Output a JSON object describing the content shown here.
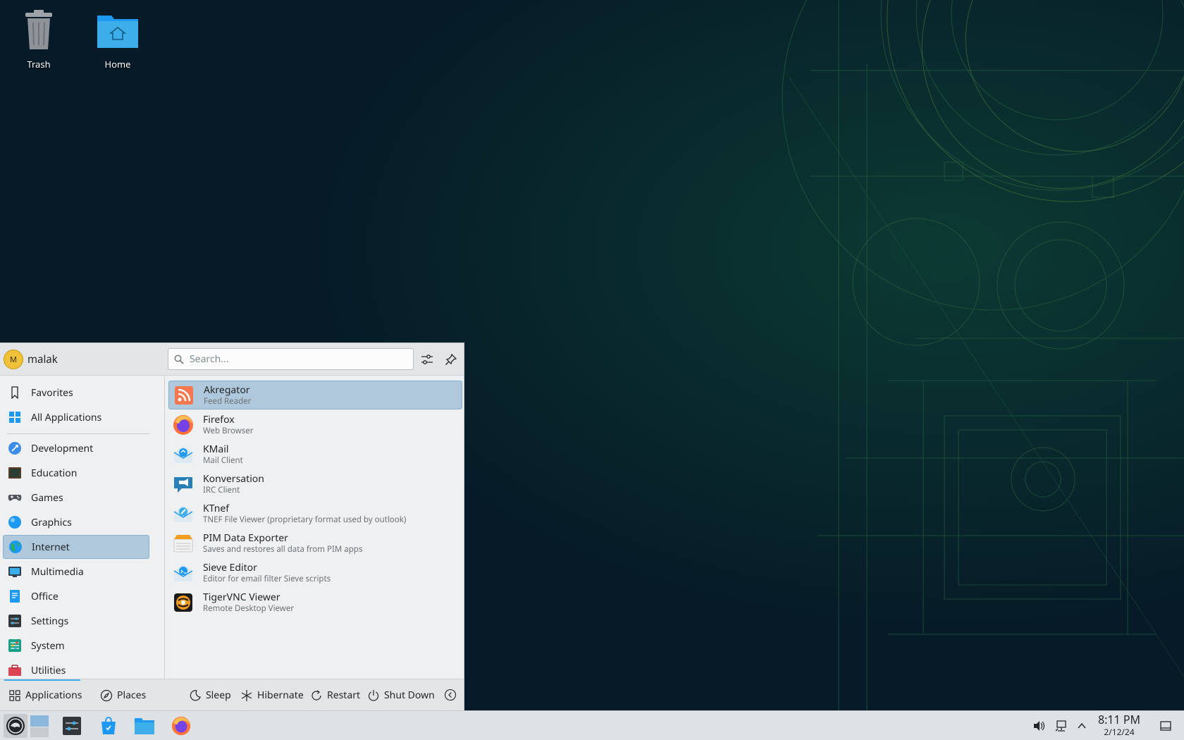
{
  "desktop": {
    "icons": [
      {
        "label": "Trash"
      },
      {
        "label": "Home"
      }
    ]
  },
  "launcher": {
    "user": {
      "initial": "M",
      "name": "malak"
    },
    "search": {
      "placeholder": "Search..."
    },
    "categories": [
      {
        "label": "Favorites",
        "icon": "bookmark-icon"
      },
      {
        "label": "All Applications",
        "icon": "grid-icon"
      },
      {
        "label": "Development",
        "icon": "development-icon"
      },
      {
        "label": "Education",
        "icon": "education-icon"
      },
      {
        "label": "Games",
        "icon": "gamepad-icon"
      },
      {
        "label": "Graphics",
        "icon": "graphics-icon"
      },
      {
        "label": "Internet",
        "icon": "globe-icon",
        "selected": true
      },
      {
        "label": "Multimedia",
        "icon": "multimedia-icon"
      },
      {
        "label": "Office",
        "icon": "office-icon"
      },
      {
        "label": "Settings",
        "icon": "settings-icon"
      },
      {
        "label": "System",
        "icon": "system-icon"
      },
      {
        "label": "Utilities",
        "icon": "utilities-icon"
      }
    ],
    "apps": [
      {
        "name": "Akregator",
        "desc": "Feed Reader",
        "icon": "rss-icon",
        "selected": true
      },
      {
        "name": "Firefox",
        "desc": "Web Browser",
        "icon": "firefox-icon"
      },
      {
        "name": "KMail",
        "desc": "Mail Client",
        "icon": "mail-icon"
      },
      {
        "name": "Konversation",
        "desc": "IRC Client",
        "icon": "chat-icon"
      },
      {
        "name": "KTnef",
        "desc": "TNEF File Viewer (proprietary format used by outlook)",
        "icon": "ktnef-icon"
      },
      {
        "name": "PIM Data Exporter",
        "desc": "Saves and restores all data from PIM apps",
        "icon": "pim-icon"
      },
      {
        "name": "Sieve Editor",
        "desc": "Editor for email filter Sieve scripts",
        "icon": "sieve-icon"
      },
      {
        "name": "TigerVNC Viewer",
        "desc": "Remote Desktop Viewer",
        "icon": "tigervnc-icon"
      }
    ],
    "footer": {
      "applications": "Applications",
      "places": "Places",
      "sleep": "Sleep",
      "hibernate": "Hibernate",
      "restart": "Restart",
      "shutdown": "Shut Down"
    }
  },
  "taskbar": {
    "clock": {
      "time": "8:11 PM",
      "date": "2/12/24"
    }
  },
  "colors": {
    "accent": "#3daee9",
    "selection": "#b0c8dc",
    "desktop_bg": "#061a27"
  }
}
